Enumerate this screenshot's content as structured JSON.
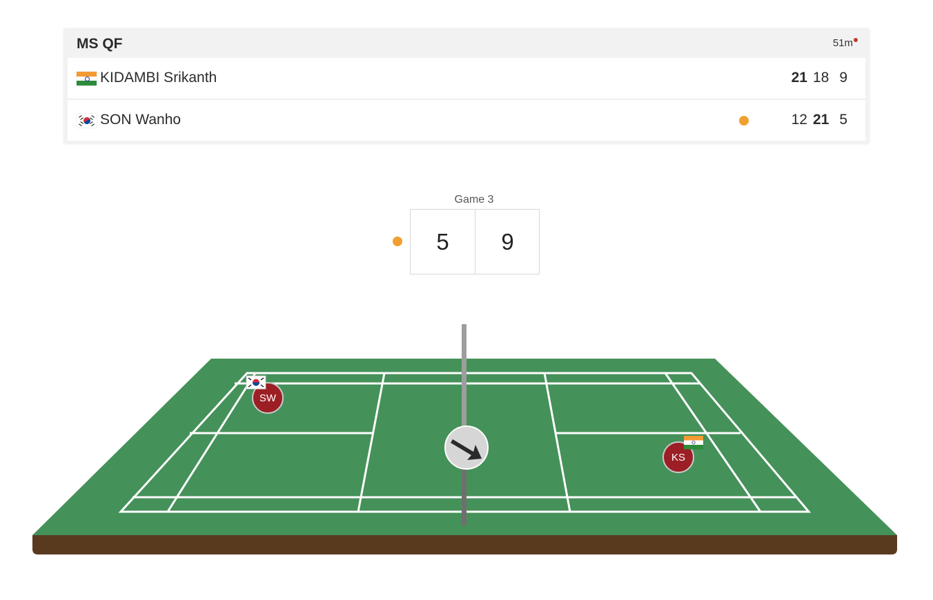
{
  "match": {
    "event": "MS QF",
    "duration": "51m",
    "status_color": "#c0392b"
  },
  "players": [
    {
      "name": "KIDAMBI Srikanth",
      "country_flag": "india-flag",
      "initials": "KS",
      "serving": false,
      "scores": [
        "21",
        "18",
        "9"
      ],
      "won_games": [
        true,
        false,
        false
      ]
    },
    {
      "name": "SON Wanho",
      "country_flag": "south-korea-flag",
      "initials": "SW",
      "serving": true,
      "scores": [
        "12",
        "21",
        "5"
      ],
      "won_games": [
        false,
        true,
        false
      ]
    }
  ],
  "current_game": {
    "label": "Game 3",
    "left_score": "5",
    "right_score": "9",
    "server_side": "left"
  },
  "court": {
    "shuttle_direction_icon": "arrow-down-right-icon",
    "court_color": "#45915a",
    "line_color": "#ffffff",
    "base_color": "#5a3a1f",
    "serve_indicator_color": "#f0a030",
    "player_badge_color": "#9b1f24"
  }
}
